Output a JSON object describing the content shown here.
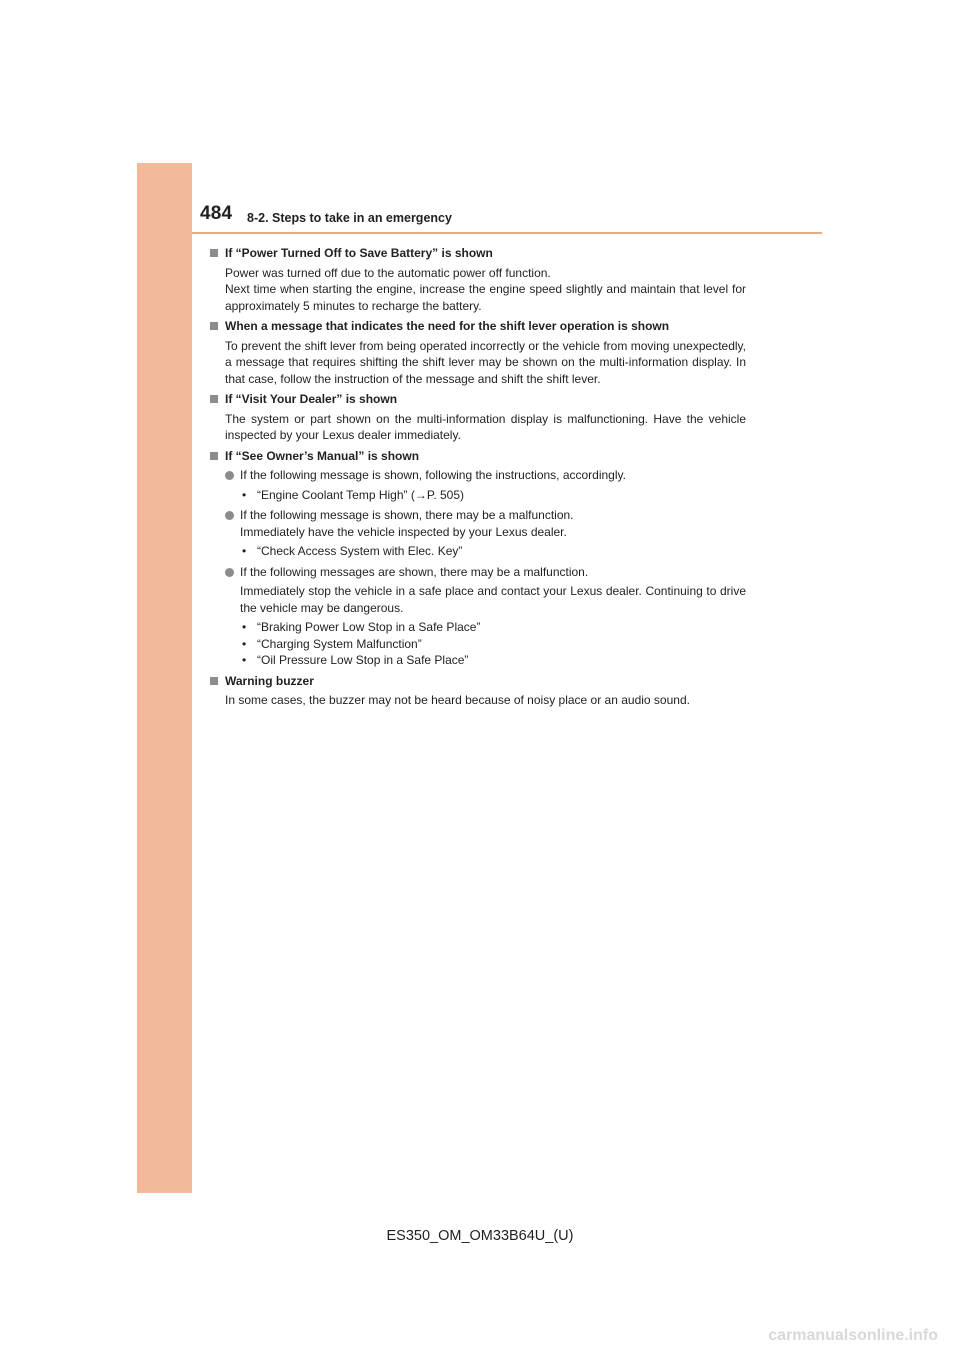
{
  "header": {
    "page_number": "484",
    "section_title": "8-2. Steps to take in an emergency"
  },
  "sections": [
    {
      "heading": "If “Power Turned Off to Save Battery” is shown",
      "text": "Power was turned off due to the automatic power off function.\nNext time when starting the engine, increase the engine speed slightly and maintain that level for approximately 5 minutes to recharge the battery."
    },
    {
      "heading": "When a message that indicates the need for the shift lever operation is shown",
      "text": "To prevent the shift lever from being operated incorrectly or the vehicle from moving unexpectedly, a message that requires shifting the shift lever may be shown on the multi-information display. In that case, follow the instruction of the message and shift the shift lever."
    },
    {
      "heading": "If “Visit Your Dealer” is shown",
      "text": "The system or part shown on the multi-information display is malfunctioning. Have the vehicle inspected by your Lexus dealer immediately."
    },
    {
      "heading": "If “See Owner’s Manual” is shown",
      "bullets": [
        {
          "text": "If the following message is shown, following the instructions, accordingly.",
          "items": [
            "“Engine Coolant Temp High” (→P. 505)"
          ]
        },
        {
          "text": "If the following message is shown, there may be a malfunction.\nImmediately have the vehicle inspected by your Lexus dealer.",
          "items": [
            "“Check Access System with Elec. Key”"
          ]
        },
        {
          "text": "If the following messages are shown, there may be a malfunction.",
          "extra": "Immediately stop the vehicle in a safe place and contact your Lexus dealer. Continuing to drive the vehicle may be dangerous.",
          "items": [
            "“Braking Power Low Stop in a Safe Place”",
            "“Charging System Malfunction”",
            "“Oil Pressure Low Stop in a Safe Place”"
          ]
        }
      ]
    },
    {
      "heading": "Warning buzzer",
      "text": "In some cases, the buzzer may not be heard because of noisy place or an audio sound."
    }
  ],
  "footer": {
    "code": "ES350_OM_OM33B64U_(U)",
    "watermark": "carmanualsonline.info"
  },
  "colors": {
    "side_band": "#f2b99a",
    "header_rule": "#e9a987",
    "marker": "#8c8c8c"
  }
}
